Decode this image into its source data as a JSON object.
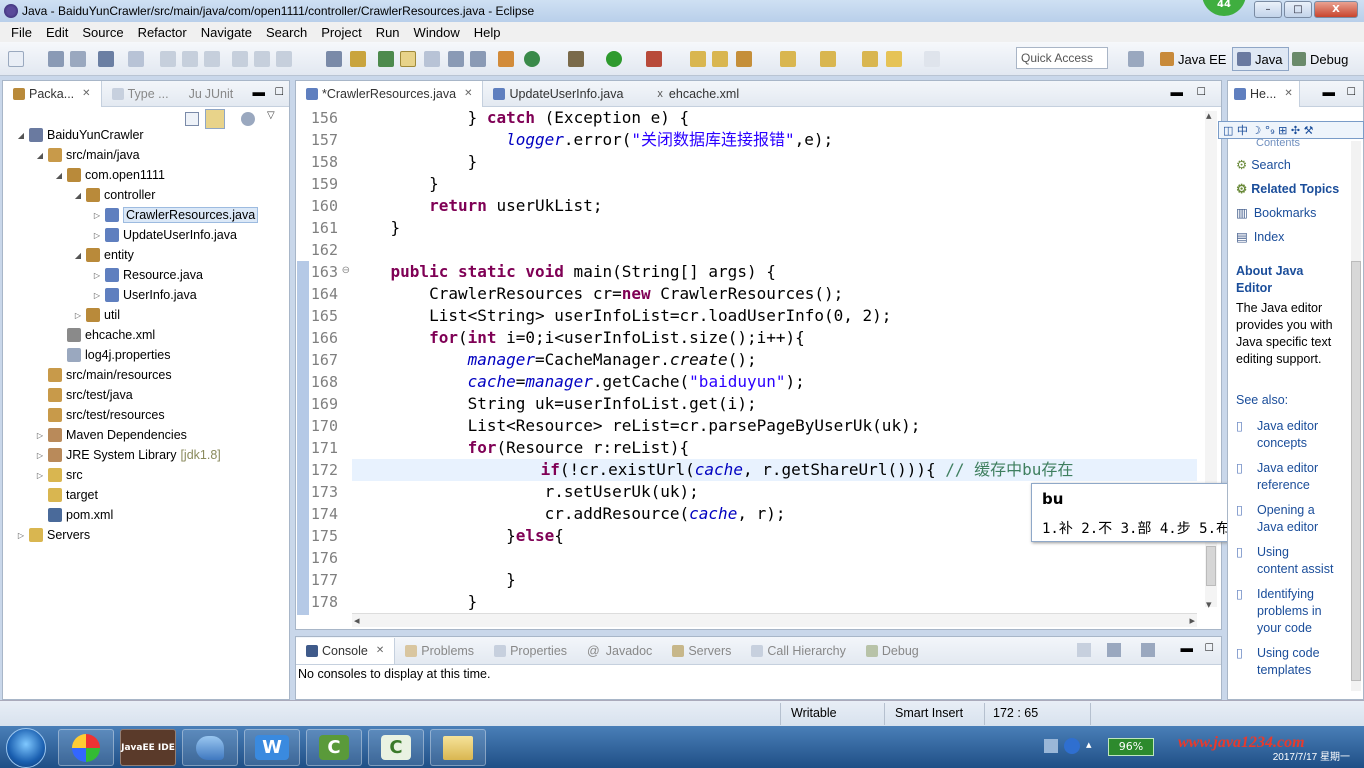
{
  "window": {
    "title": "Java - BaiduYunCrawler/src/main/java/com/open1111/controller/CrawlerResources.java - Eclipse",
    "badge": "44",
    "minimize": "–",
    "maximize": "□",
    "close": "X"
  },
  "menu": [
    "File",
    "Edit",
    "Source",
    "Refactor",
    "Navigate",
    "Search",
    "Project",
    "Run",
    "Window",
    "Help"
  ],
  "toolbar": {
    "quick_access": "Quick Access",
    "perspectives": [
      "Java EE",
      "Java",
      "Debug"
    ]
  },
  "package_explorer": {
    "tabs": [
      "Packa...",
      "Type ...",
      "JUnit"
    ],
    "tree": [
      {
        "label": "BaiduYunCrawler",
        "depth": 0,
        "twisty": "◢",
        "icon": "project"
      },
      {
        "label": "src/main/java",
        "depth": 1,
        "twisty": "◢",
        "icon": "srcfolder"
      },
      {
        "label": "com.open1111",
        "depth": 2,
        "twisty": "◢",
        "icon": "package"
      },
      {
        "label": "controller",
        "depth": 3,
        "twisty": "◢",
        "icon": "package"
      },
      {
        "label": "CrawlerResources.java",
        "depth": 4,
        "twisty": "▷",
        "icon": "java",
        "selected": true
      },
      {
        "label": "UpdateUserInfo.java",
        "depth": 4,
        "twisty": "▷",
        "icon": "java"
      },
      {
        "label": "entity",
        "depth": 3,
        "twisty": "◢",
        "icon": "package"
      },
      {
        "label": "Resource.java",
        "depth": 4,
        "twisty": "▷",
        "icon": "java"
      },
      {
        "label": "UserInfo.java",
        "depth": 4,
        "twisty": "▷",
        "icon": "java"
      },
      {
        "label": "util",
        "depth": 3,
        "twisty": "▷",
        "icon": "package"
      },
      {
        "label": "ehcache.xml",
        "depth": 2,
        "twisty": "",
        "icon": "xml"
      },
      {
        "label": "log4j.properties",
        "depth": 2,
        "twisty": "",
        "icon": "props"
      },
      {
        "label": "src/main/resources",
        "depth": 1,
        "twisty": "",
        "icon": "srcfolder"
      },
      {
        "label": "src/test/java",
        "depth": 1,
        "twisty": "",
        "icon": "srcfolder"
      },
      {
        "label": "src/test/resources",
        "depth": 1,
        "twisty": "",
        "icon": "srcfolder"
      },
      {
        "label": "Maven Dependencies",
        "depth": 1,
        "twisty": "▷",
        "icon": "lib"
      },
      {
        "label": "JRE System Library",
        "depth": 1,
        "twisty": "▷",
        "icon": "lib",
        "annotation": "[jdk1.8]"
      },
      {
        "label": "src",
        "depth": 1,
        "twisty": "▷",
        "icon": "folder"
      },
      {
        "label": "target",
        "depth": 1,
        "twisty": "",
        "icon": "folder"
      },
      {
        "label": "pom.xml",
        "depth": 1,
        "twisty": "",
        "icon": "pom"
      },
      {
        "label": "Servers",
        "depth": 0,
        "twisty": "▷",
        "icon": "folder"
      }
    ]
  },
  "editor": {
    "tabs": [
      "*CrawlerResources.java",
      "UpdateUserInfo.java",
      "ehcache.xml"
    ],
    "line_numbers": [
      "156",
      "157",
      "158",
      "159",
      "160",
      "161",
      "162",
      "163",
      "164",
      "165",
      "166",
      "167",
      "168",
      "169",
      "170",
      "171",
      "172",
      "173",
      "174",
      "175",
      "176",
      "177",
      "178"
    ],
    "fold_marker": "⊖",
    "ime": {
      "input": "bu",
      "candidates": "1.补 2.不 3.部 4.步 5.布",
      "arrows": "◂ ▸"
    }
  },
  "console": {
    "tabs": [
      "Console",
      "Problems",
      "Properties",
      "Javadoc",
      "Servers",
      "Call Hierarchy",
      "Debug"
    ],
    "message": "No consoles to display at this time."
  },
  "help": {
    "tab": "He...",
    "links_top": [
      "Contents",
      "Search",
      "Related Topics",
      "Bookmarks",
      "Index"
    ],
    "section_title_1": "About Java",
    "section_title_2": "Editor",
    "description": "The Java editor provides you with Java specific text editing support.",
    "see_also": "See also:",
    "links": [
      [
        "Java editor",
        "concepts"
      ],
      [
        "Java editor",
        "reference"
      ],
      [
        "Opening a",
        "Java editor"
      ],
      [
        "Using",
        "content assist"
      ],
      [
        "Identifying",
        "problems in",
        "your code"
      ],
      [
        "Using code",
        "templates"
      ]
    ]
  },
  "status": {
    "writable": "Writable",
    "insert_mode": "Smart Insert",
    "position": "172 : 65"
  },
  "taskbar": {
    "apps": [
      "JavaEE IDE",
      "W",
      "C",
      "C"
    ],
    "battery": "96%",
    "watermark": "www.java1234.com",
    "clock": "2017/7/17 星期一"
  },
  "colors": {
    "keyword": "#7f0055",
    "string": "#2a00ff",
    "field": "#0000c0",
    "comment": "#3f7f5f",
    "current_line": "#e8f2fe"
  }
}
